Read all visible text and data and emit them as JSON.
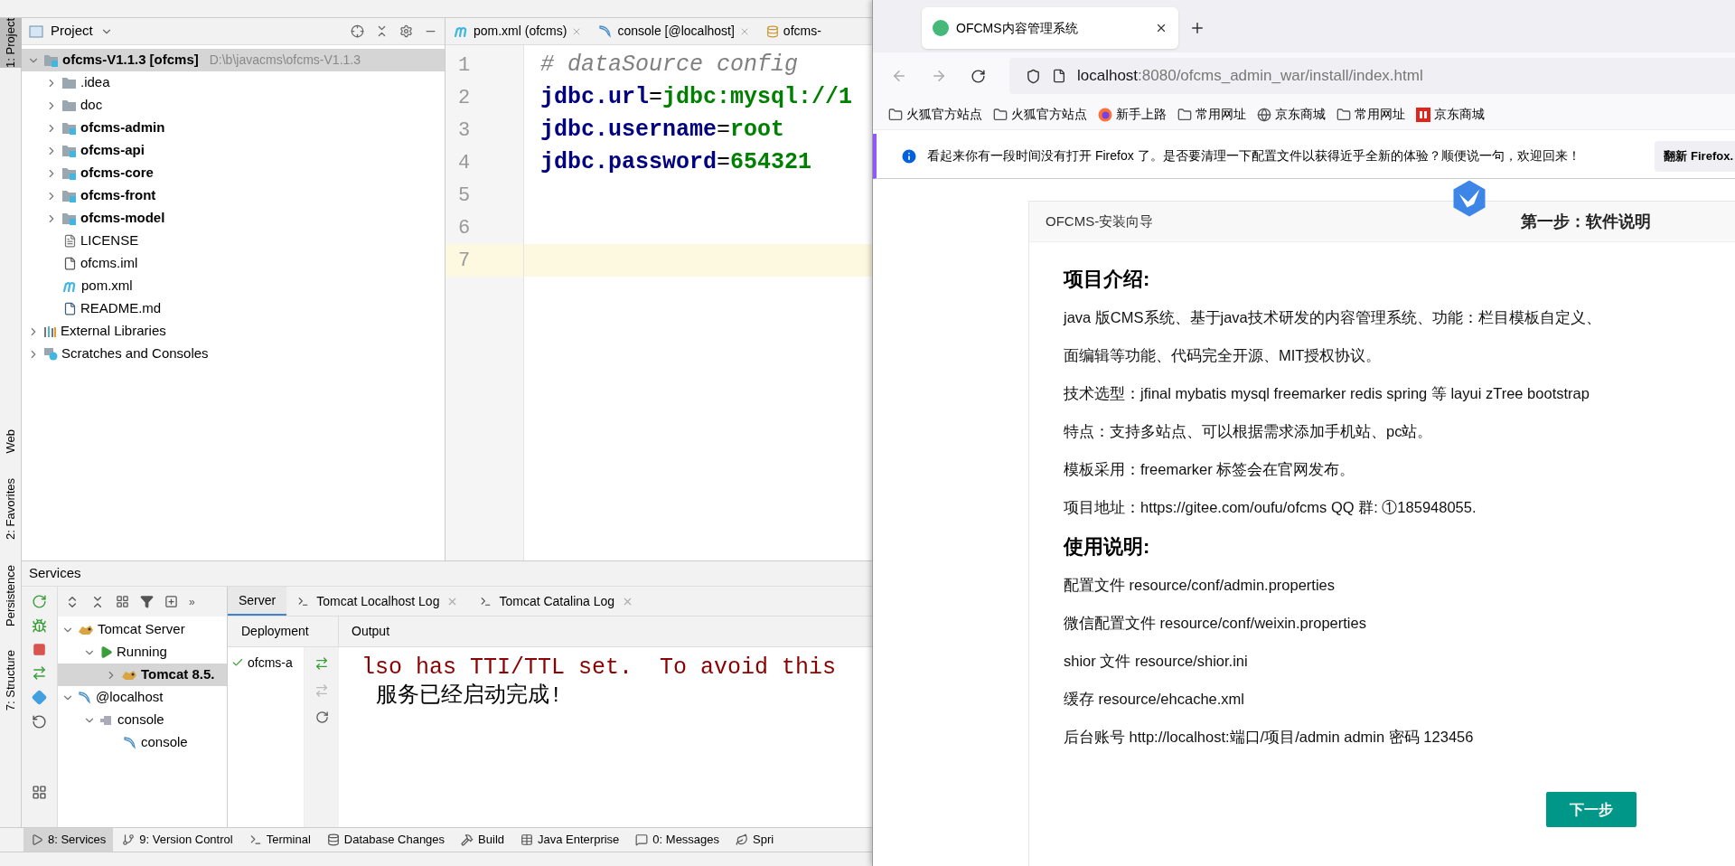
{
  "ide": {
    "left_stripe": [
      {
        "label": "1: Project",
        "selected": true
      },
      {
        "label": "Web",
        "selected": false
      },
      {
        "label": "2: Favorites",
        "selected": false
      },
      {
        "label": "Persistence",
        "selected": false
      },
      {
        "label": "7: Structure",
        "selected": false
      }
    ],
    "project_panel": {
      "title": "Project",
      "tree": [
        {
          "name": "ofcms-V1.1.3",
          "module": "[ofcms]",
          "path": "D:\\b\\javacms\\ofcms-V1.1.3",
          "kind": "project",
          "expanded": true,
          "selected": true,
          "children": [
            {
              "name": ".idea",
              "kind": "folder",
              "expanded": false,
              "selected": false
            },
            {
              "name": "doc",
              "kind": "folder",
              "expanded": false,
              "selected": false
            },
            {
              "name": "ofcms-admin",
              "kind": "module",
              "expanded": false,
              "selected": false
            },
            {
              "name": "ofcms-api",
              "kind": "module",
              "expanded": false,
              "selected": false
            },
            {
              "name": "ofcms-core",
              "kind": "module",
              "expanded": false,
              "selected": false
            },
            {
              "name": "ofcms-front",
              "kind": "module",
              "expanded": false,
              "selected": false
            },
            {
              "name": "ofcms-model",
              "kind": "module",
              "expanded": false,
              "selected": false
            },
            {
              "name": "LICENSE",
              "kind": "text",
              "selected": false
            },
            {
              "name": "ofcms.iml",
              "kind": "iml",
              "selected": false
            },
            {
              "name": "pom.xml",
              "kind": "maven",
              "selected": false
            },
            {
              "name": "README.md",
              "kind": "markdown",
              "selected": false
            }
          ]
        },
        {
          "name": "External Libraries",
          "kind": "libraries",
          "expanded": false,
          "selected": false
        },
        {
          "name": "Scratches and Consoles",
          "kind": "scratches",
          "expanded": false,
          "selected": false
        }
      ]
    },
    "editor": {
      "tabs": [
        {
          "label": "pom.xml (ofcms)",
          "kind": "maven",
          "selected": false
        },
        {
          "label": "console [@localhost]",
          "kind": "console",
          "selected": false
        },
        {
          "label": "ofcms-",
          "kind": "sql",
          "selected": false
        }
      ],
      "lines": [
        {
          "number": "1",
          "current": false,
          "tokens": [
            {
              "text": "# dataSource config",
              "kind": "comment"
            }
          ]
        },
        {
          "number": "2",
          "current": false,
          "tokens": [
            {
              "text": "jdbc.url",
              "kind": "key"
            },
            {
              "text": "=",
              "kind": "sep"
            },
            {
              "text": "jdbc:mysql://1",
              "kind": "value"
            }
          ]
        },
        {
          "number": "3",
          "current": false,
          "tokens": [
            {
              "text": "jdbc.username",
              "kind": "key"
            },
            {
              "text": "=",
              "kind": "sep"
            },
            {
              "text": "root",
              "kind": "value"
            }
          ]
        },
        {
          "number": "4",
          "current": false,
          "tokens": [
            {
              "text": "jdbc.password",
              "kind": "key"
            },
            {
              "text": "=",
              "kind": "sep"
            },
            {
              "text": "654321",
              "kind": "value"
            }
          ]
        },
        {
          "number": "5",
          "current": false
        },
        {
          "number": "6",
          "current": false
        },
        {
          "number": "7",
          "current": true
        }
      ]
    },
    "services": {
      "title": "Services",
      "more": "»",
      "tree": [
        {
          "name": "Tomcat Server",
          "kind": "tomcat",
          "expanded": true,
          "selected": false,
          "children": [
            {
              "name": "Running",
              "kind": "running",
              "expanded": true,
              "selected": false,
              "children": [
                {
                  "name": "Tomcat 8.5.",
                  "kind": "tomcat-instance",
                  "expanded": false,
                  "selected": true
                }
              ]
            }
          ]
        },
        {
          "name": "@localhost",
          "kind": "database",
          "expanded": true,
          "selected": false,
          "children": [
            {
              "name": "console",
              "kind": "console-group",
              "expanded": true,
              "selected": false,
              "children": [
                {
                  "name": "console",
                  "kind": "console",
                  "selected": false
                }
              ]
            }
          ]
        }
      ],
      "tabs": [
        {
          "label": "Server",
          "kind": "plain",
          "selected": true
        },
        {
          "label": "Tomcat Localhost Log",
          "kind": "log",
          "selected": false
        },
        {
          "label": "Tomcat Catalina Log",
          "kind": "log",
          "selected": false
        }
      ],
      "deployment_header": "Deployment",
      "output_header": "Output",
      "deployments": [
        {
          "name": "ofcms-a",
          "deployed": true
        }
      ],
      "output": [
        {
          "text": "lso has TTI/TTL set.  To avoid this",
          "kind": "error"
        },
        {
          "text": "服务已经启动完成!",
          "kind": "info"
        }
      ]
    },
    "tool_windows": [
      {
        "label": "8: Services",
        "kind": "services",
        "selected": true
      },
      {
        "label": "9: Version Control",
        "kind": "vcs",
        "selected": false
      },
      {
        "label": "Terminal",
        "kind": "terminal",
        "selected": false
      },
      {
        "label": "Database Changes",
        "kind": "database",
        "selected": false
      },
      {
        "label": "Build",
        "kind": "build",
        "selected": false
      },
      {
        "label": "Java Enterprise",
        "kind": "enterprise",
        "selected": false
      },
      {
        "label": "0: Messages",
        "kind": "messages",
        "selected": false
      },
      {
        "label": "Spri",
        "kind": "spring",
        "selected": false
      }
    ]
  },
  "browser": {
    "tab": {
      "title": "OFCMS内容管理系统",
      "selected": true
    },
    "url": {
      "host": "localhost",
      "rest": ":8080/ofcms_admin_war/install/index.html"
    },
    "bookmarks": [
      {
        "label": "火狐官方站点",
        "kind": "folder"
      },
      {
        "label": "火狐官方站点",
        "kind": "folder"
      },
      {
        "label": "新手上路",
        "kind": "firefox"
      },
      {
        "label": "常用网址",
        "kind": "folder"
      },
      {
        "label": "京东商城",
        "kind": "globe"
      },
      {
        "label": "常用网址",
        "kind": "folder"
      },
      {
        "label": "京东商城",
        "kind": "jd"
      }
    ],
    "notification": {
      "text": "看起来你有一段时间没有打开 Firefox 了。是否要清理一下配置文件以获得近乎全新的体验？顺便说一句，欢迎回来！",
      "button": "翻新 Firefox."
    },
    "page": {
      "header_title": "OFCMS-安装向导",
      "step_title": "第一步：软件说明",
      "sections": [
        {
          "heading": "项目介绍:",
          "lines": [
            "java 版CMS系统、基于java技术研发的内容管理系统、功能：栏目模板自定义、",
            "面编辑等功能、代码完全开源、MIT授权协议。",
            "技术选型：jfinal mybatis mysql freemarker redis spring 等 layui zTree bootstrap",
            "特点：支持多站点、可以根据需求添加手机站、pc站。",
            "模板采用：freemarker 标签会在官网发布。",
            "项目地址：https://gitee.com/oufu/ofcms QQ 群: ①185948055."
          ]
        },
        {
          "heading": "使用说明:",
          "lines": [
            "配置文件 resource/conf/admin.properties",
            "微信配置文件 resource/conf/weixin.properties",
            "shior 文件 resource/shior.ini",
            "缓存 resource/ehcache.xml",
            "后台账号 http://localhost:端口/项目/admin admin 密码 123456"
          ]
        }
      ],
      "next_button": "下一步"
    }
  }
}
